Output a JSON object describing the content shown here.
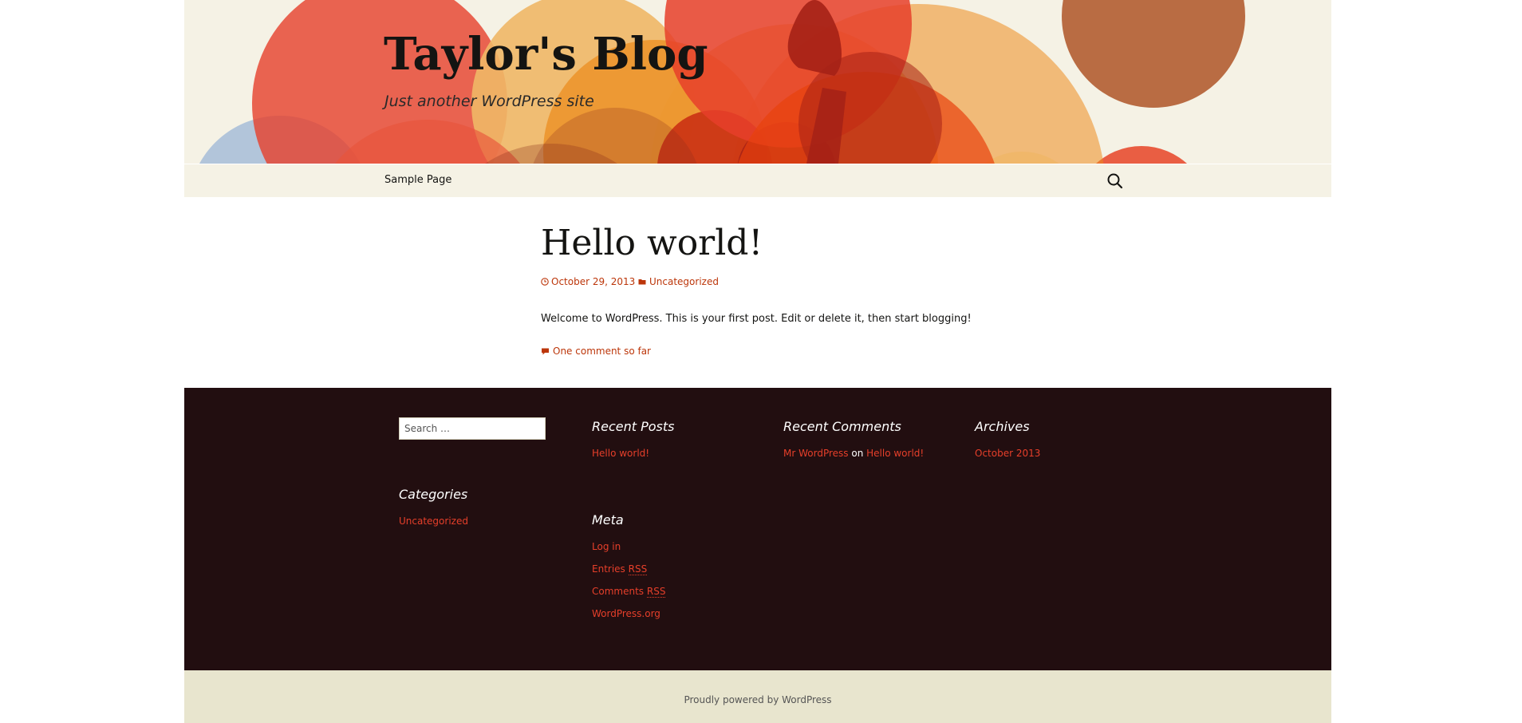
{
  "header": {
    "site_title": "Taylor's Blog",
    "tagline": "Just another WordPress site",
    "colors": {
      "background": "#f5f2e5",
      "circle_red": "#e63f2a",
      "circle_orange": "#ec8d1f",
      "circle_light_orange": "#f0b766",
      "circle_dark_red": "#a52116",
      "circle_brown": "#b5643a",
      "circle_blue": "#9bb6d6"
    }
  },
  "nav": {
    "items": [
      {
        "label": "Sample Page"
      }
    ],
    "search_icon": "search-icon"
  },
  "post": {
    "title": "Hello world!",
    "date": "October 29, 2013",
    "date_icon": "clock-icon",
    "category": "Uncategorized",
    "category_icon": "folder-icon",
    "body": "Welcome to WordPress. This is your first post. Edit or delete it, then start blogging!",
    "comments_link": "One comment so far",
    "comments_icon": "comment-icon"
  },
  "footer_widgets": {
    "search": {
      "placeholder": "Search …"
    },
    "recent_posts": {
      "title": "Recent Posts",
      "items": [
        "Hello world!"
      ]
    },
    "recent_comments": {
      "title": "Recent Comments",
      "author": "Mr WordPress",
      "connector": "on",
      "post": "Hello world!"
    },
    "archives": {
      "title": "Archives",
      "items": [
        "October 2013"
      ]
    },
    "categories": {
      "title": "Categories",
      "items": [
        "Uncategorized"
      ]
    },
    "meta": {
      "title": "Meta",
      "log_in": "Log in",
      "entries_prefix": "Entries",
      "comments_prefix": "Comments",
      "rss": "RSS",
      "wordpress_org": "WordPress.org"
    },
    "colors": {
      "background": "#220e10",
      "link": "#e63f2a"
    }
  },
  "site_footer": {
    "powered_by": "Proudly powered by WordPress",
    "background": "#e8e5ce"
  },
  "theme": {
    "accent": "#bc360a"
  }
}
